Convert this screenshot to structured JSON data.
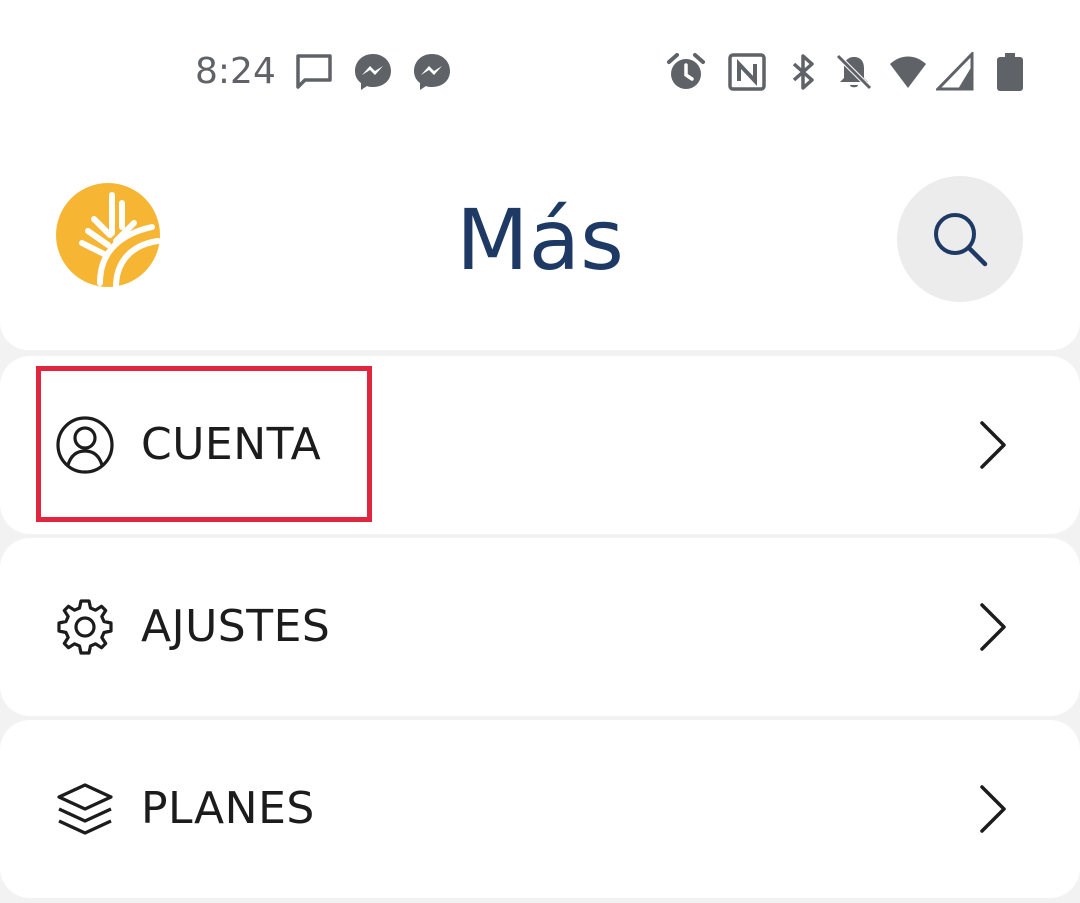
{
  "status_bar": {
    "time": "8:24",
    "icons": [
      "message-icon",
      "messenger-icon",
      "messenger-icon",
      "alarm-icon",
      "nfc-icon",
      "bluetooth-icon",
      "notifications-off-icon",
      "wifi-icon",
      "signal-icon",
      "battery-icon"
    ]
  },
  "header": {
    "title": "Más",
    "logo_icon": "wheat-logo-icon",
    "search_icon": "search-icon"
  },
  "menu": {
    "items": [
      {
        "label": "CUENTA",
        "icon": "account-icon"
      },
      {
        "label": "AJUSTES",
        "icon": "settings-gear-icon"
      },
      {
        "label": "PLANES",
        "icon": "layers-icon"
      }
    ]
  },
  "colors": {
    "brand_yellow": "#f6b634",
    "title_navy": "#1e3a64",
    "highlight_red": "#e0263f",
    "background": "#f2f2f2"
  }
}
